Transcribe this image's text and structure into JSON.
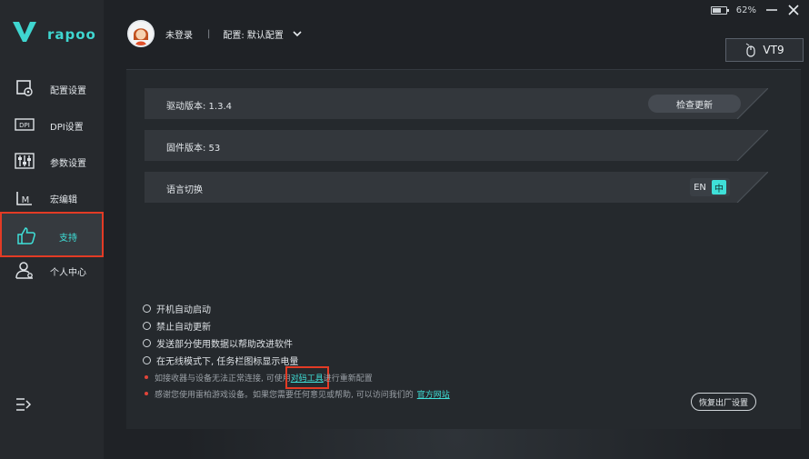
{
  "app": {
    "logo_text": "rapoo",
    "battery_percent": 62,
    "battery_text": "62%",
    "accent": "#3fe0d8",
    "highlight": "#e33b25"
  },
  "sidebar": {
    "items": [
      {
        "label": "配置设置",
        "icon": "config-icon"
      },
      {
        "label": "DPI设置",
        "icon": "dpi-icon"
      },
      {
        "label": "参数设置",
        "icon": "sliders-icon"
      },
      {
        "label": "宏编辑",
        "icon": "macro-icon"
      },
      {
        "label": "支持",
        "icon": "thumbs-up-icon",
        "active": true
      },
      {
        "label": "个人中心",
        "icon": "user-icon"
      }
    ]
  },
  "header": {
    "login": "未登录",
    "separator": "|",
    "config": "配置: 默认配置"
  },
  "device": {
    "name": "VT9"
  },
  "rows": {
    "driver_version": "驱动版本: 1.3.4",
    "check_update": "检查更新",
    "firmware_version": "固件版本: 53",
    "language": "语言切换",
    "lang_en": "EN",
    "lang_zh": "中"
  },
  "options": [
    "开机自动启动",
    "禁止自动更新",
    "发送部分使用数据以帮助改进软件",
    "在无线模式下, 任务栏图标显示电量"
  ],
  "notes": {
    "pair_prefix": "如接收器与设备无法正常连接, 可使用",
    "pair_link": "对码工具",
    "pair_suffix": "进行重新配置",
    "thanks_prefix": "感谢您使用雷柏游戏设备。如果您需要任何意见或帮助, 可以访问我们的",
    "thanks_link": "官方网站"
  },
  "reset_button": "恢复出厂设置"
}
